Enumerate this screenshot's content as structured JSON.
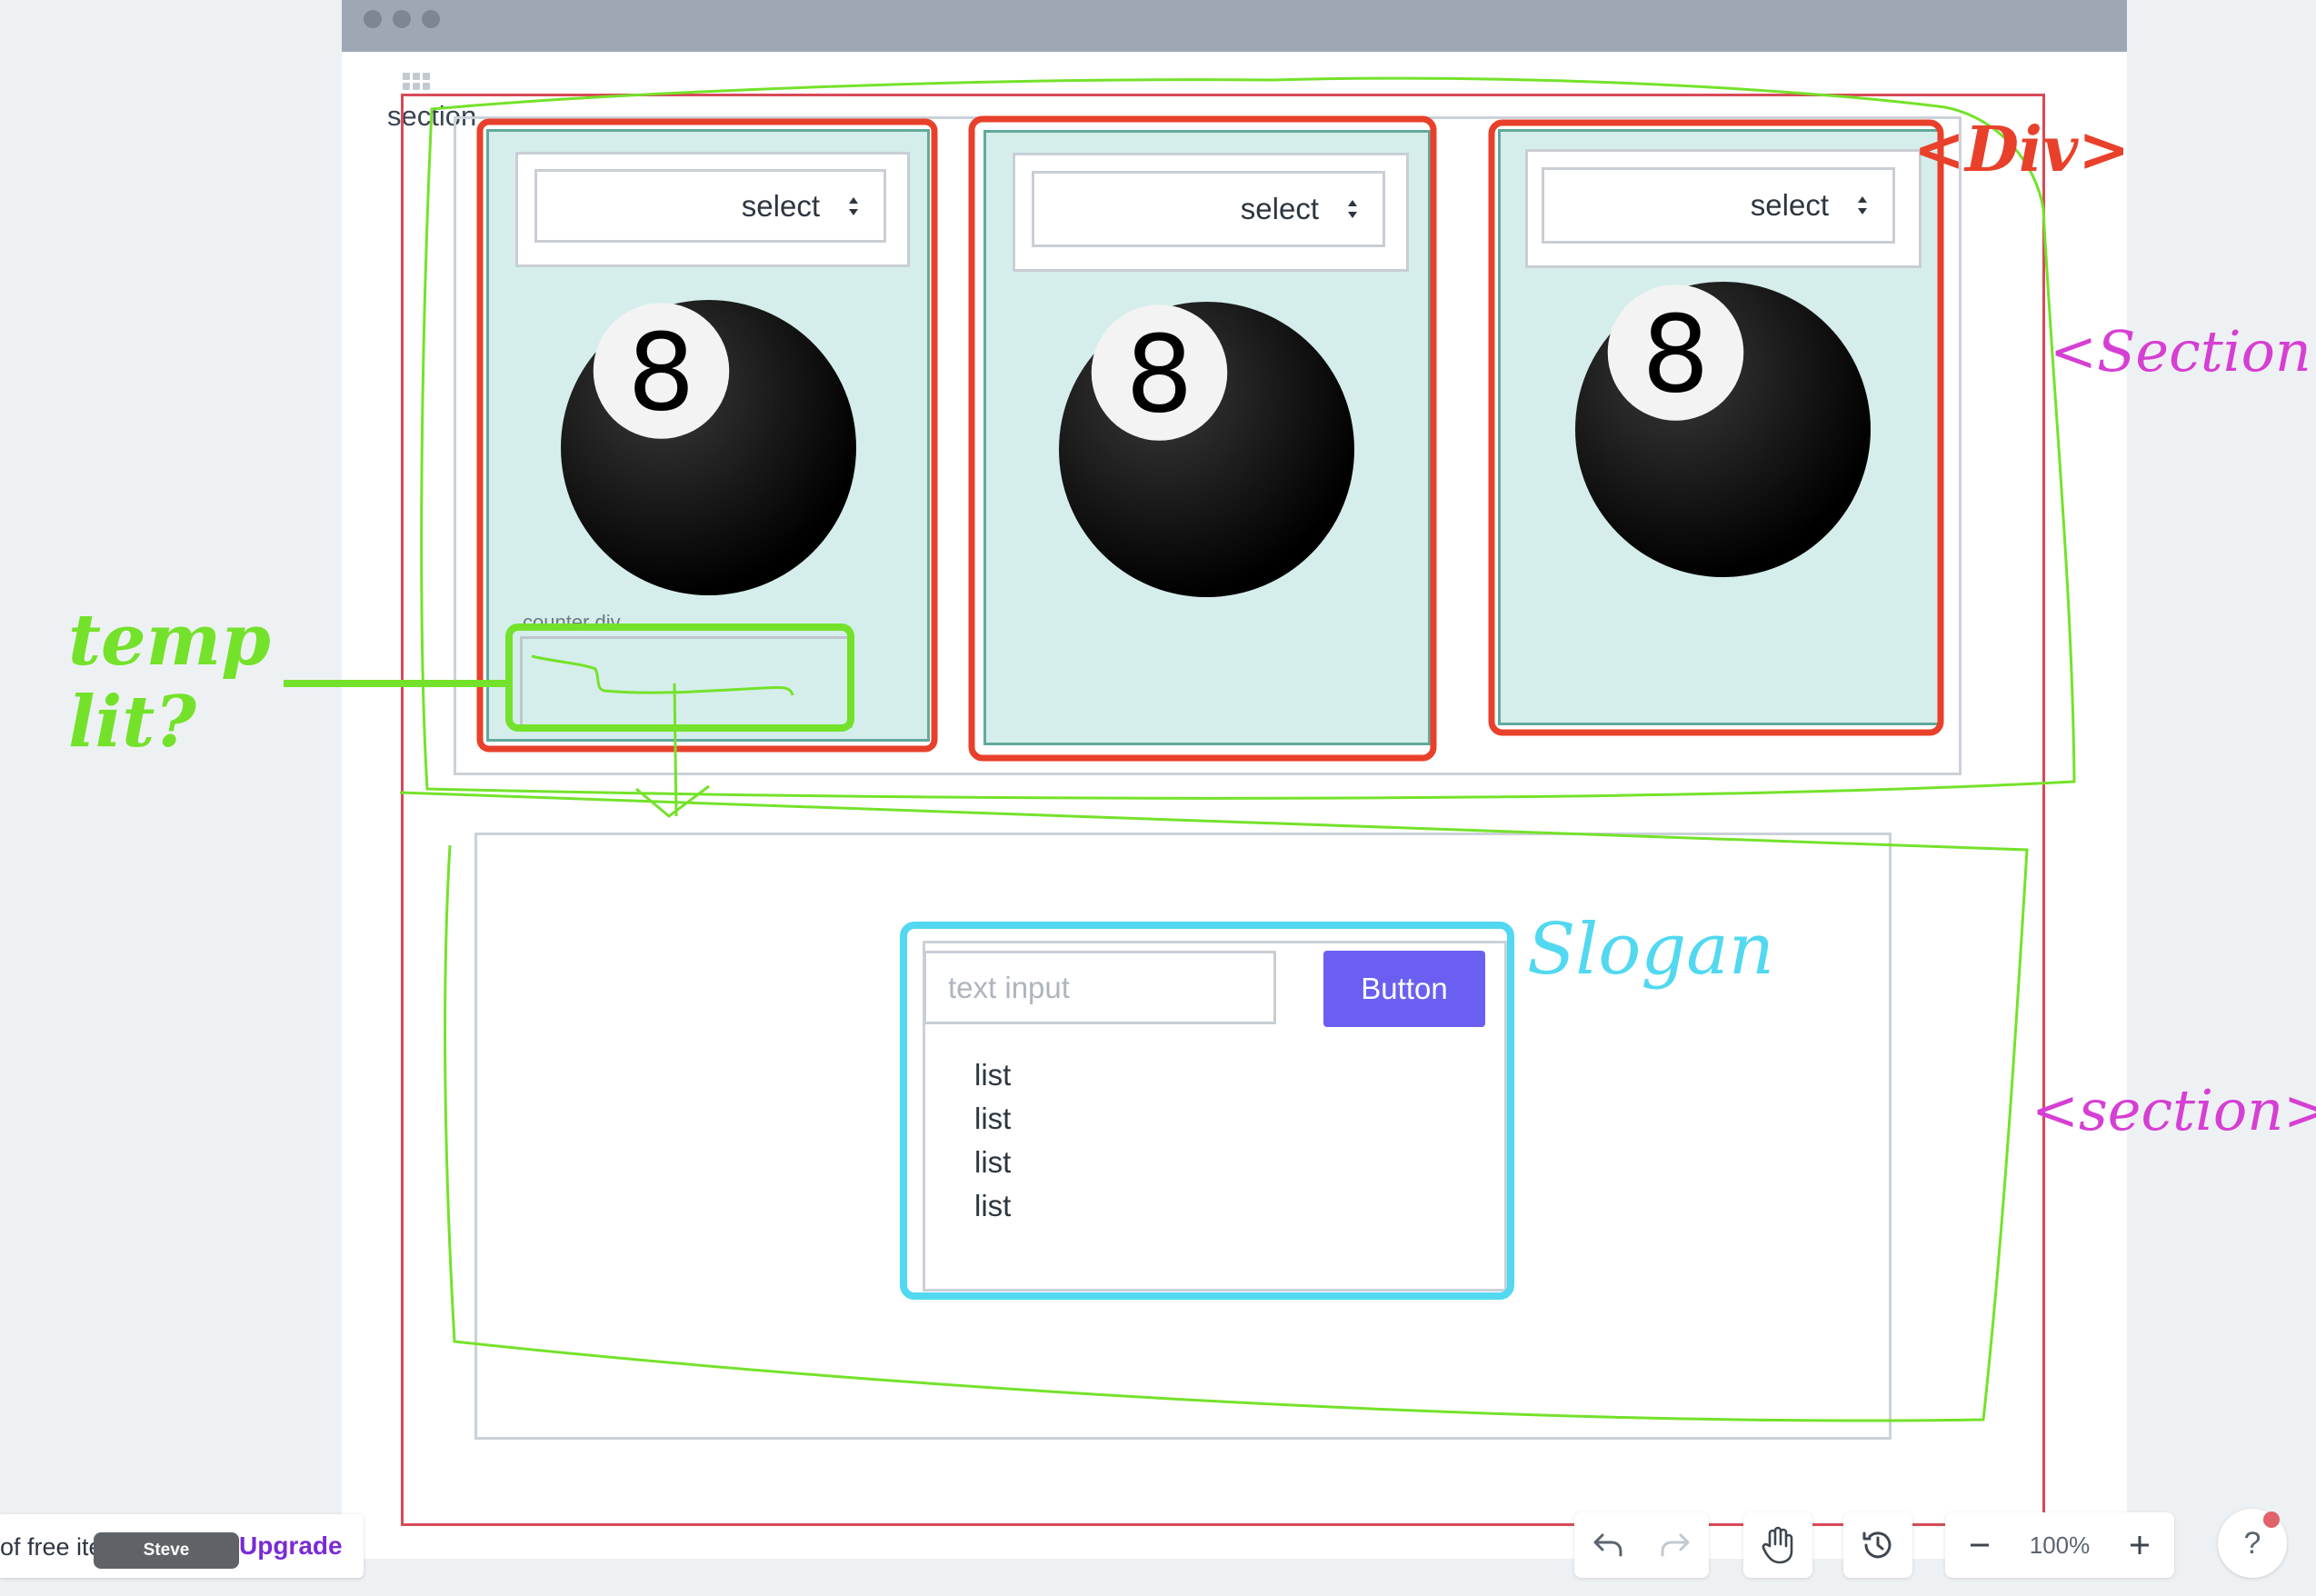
{
  "window": {
    "traffic_dots": 3
  },
  "wireframe": {
    "section_label": "section",
    "cards": [
      {
        "select_label": "select"
      },
      {
        "select_label": "select"
      },
      {
        "select_label": "select"
      }
    ],
    "ball_number": "8",
    "counter_label": "counter div",
    "slogan": {
      "input_placeholder": "text input",
      "button_label": "Button",
      "list_items": [
        "list",
        "list",
        "list",
        "list"
      ]
    }
  },
  "annotations": {
    "div_tag": "<Div>",
    "section_tag_top": "<Section>",
    "section_tag_bottom": "<section>",
    "temp_lit": "temp lit?",
    "slogan": "Slogan",
    "colors": {
      "red": "#e8402a",
      "green": "#74e22a",
      "magenta": "#d63fd3",
      "cyan": "#52d8f1"
    }
  },
  "bottom_bar": {
    "free_items_text": "of free ite",
    "user_badge": "Steve",
    "upgrade_label": "Upgrade",
    "zoom_level": "100%",
    "help_label": "?"
  }
}
